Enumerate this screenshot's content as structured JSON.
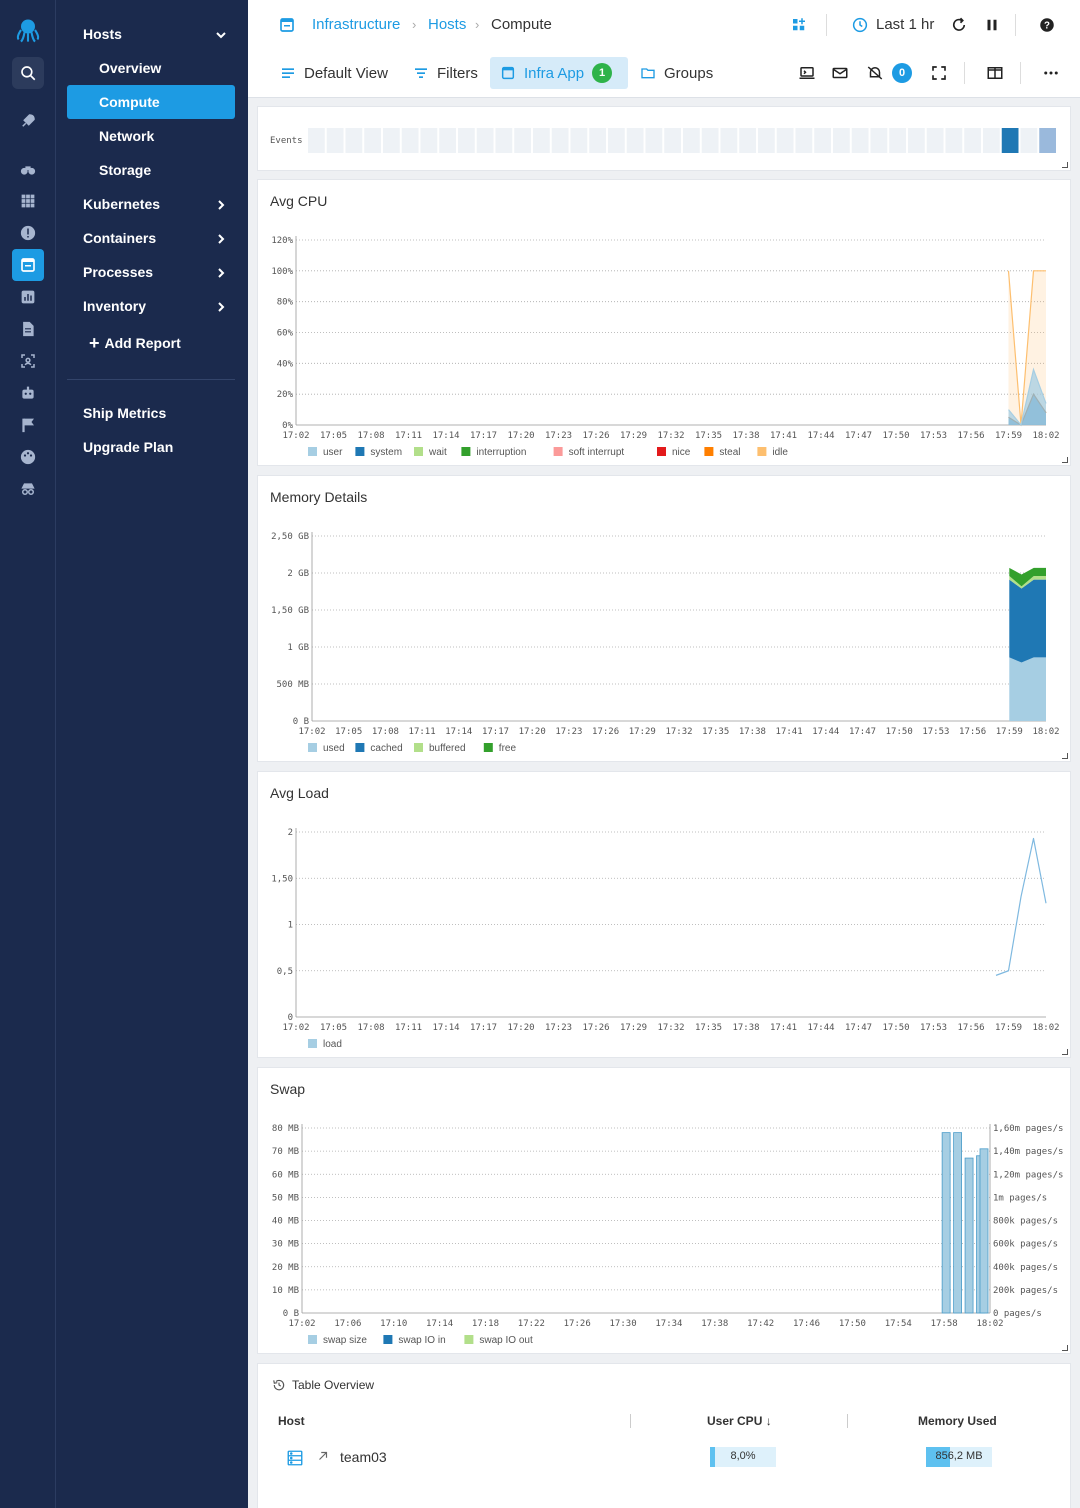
{
  "nav": {
    "hosts": "Hosts",
    "overview": "Overview",
    "compute": "Compute",
    "network": "Network",
    "storage": "Storage",
    "kubernetes": "Kubernetes",
    "containers": "Containers",
    "processes": "Processes",
    "inventory": "Inventory",
    "add_report": "Add Report",
    "ship_metrics": "Ship Metrics",
    "upgrade_plan": "Upgrade Plan"
  },
  "breadcrumb": {
    "infrastructure": "Infrastructure",
    "hosts": "Hosts",
    "current": "Compute"
  },
  "header": {
    "time_range": "Last 1 hr"
  },
  "toolbar": {
    "default_view": "Default View",
    "filters": "Filters",
    "infra_app": "Infra App",
    "infra_app_count": "1",
    "groups": "Groups",
    "alerts_count": "0"
  },
  "events": {
    "label": "Events"
  },
  "colors": {
    "accent": "#1d9be3",
    "nav_bg": "#1b2a4d",
    "green_badge": "#2eb34a"
  },
  "charts": {
    "cpu": {
      "title": "Avg CPU",
      "y_ticks": [
        "0%",
        "20%",
        "40%",
        "60%",
        "80%",
        "100%",
        "120%"
      ],
      "x_ticks": [
        "17:02",
        "17:05",
        "17:08",
        "17:11",
        "17:14",
        "17:17",
        "17:20",
        "17:23",
        "17:26",
        "17:29",
        "17:32",
        "17:35",
        "17:38",
        "17:41",
        "17:44",
        "17:47",
        "17:50",
        "17:53",
        "17:56",
        "17:59",
        "18:02"
      ],
      "legend": [
        {
          "label": "user",
          "color": "#a6cee3"
        },
        {
          "label": "system",
          "color": "#1f78b4"
        },
        {
          "label": "wait",
          "color": "#b2df8a"
        },
        {
          "label": "interruption",
          "color": "#33a02c"
        },
        {
          "label": "soft interrupt",
          "color": "#fb9a99"
        },
        {
          "label": "nice",
          "color": "#e31a1c"
        },
        {
          "label": "steal",
          "color": "#ff7f00"
        },
        {
          "label": "idle",
          "color": "#fdbf6f"
        }
      ]
    },
    "memory": {
      "title": "Memory Details",
      "y_ticks": [
        "0 B",
        "500 MB",
        "1 GB",
        "1,50 GB",
        "2 GB",
        "2,50 GB"
      ],
      "x_ticks": [
        "17:02",
        "17:05",
        "17:08",
        "17:11",
        "17:14",
        "17:17",
        "17:20",
        "17:23",
        "17:26",
        "17:29",
        "17:32",
        "17:35",
        "17:38",
        "17:41",
        "17:44",
        "17:47",
        "17:50",
        "17:53",
        "17:56",
        "17:59",
        "18:02"
      ],
      "legend": [
        {
          "label": "used",
          "color": "#a6cee3"
        },
        {
          "label": "cached",
          "color": "#1f78b4"
        },
        {
          "label": "buffered",
          "color": "#b2df8a"
        },
        {
          "label": "free",
          "color": "#33a02c"
        }
      ]
    },
    "load": {
      "title": "Avg Load",
      "y_ticks": [
        "0",
        "0,5",
        "1",
        "1,50",
        "2"
      ],
      "x_ticks": [
        "17:02",
        "17:05",
        "17:08",
        "17:11",
        "17:14",
        "17:17",
        "17:20",
        "17:23",
        "17:26",
        "17:29",
        "17:32",
        "17:35",
        "17:38",
        "17:41",
        "17:44",
        "17:47",
        "17:50",
        "17:53",
        "17:56",
        "17:59",
        "18:02"
      ],
      "legend": [
        {
          "label": "load",
          "color": "#a6cee3"
        }
      ]
    },
    "swap": {
      "title": "Swap",
      "y_ticks": [
        "0 B",
        "10 MB",
        "20 MB",
        "30 MB",
        "40 MB",
        "50 MB",
        "60 MB",
        "70 MB",
        "80 MB"
      ],
      "y2_ticks": [
        "0 pages/s",
        "200k pages/s",
        "400k pages/s",
        "600k pages/s",
        "800k pages/s",
        "1m pages/s",
        "1,20m pages/s",
        "1,40m pages/s",
        "1,60m pages/s"
      ],
      "x_ticks": [
        "17:02",
        "17:06",
        "17:10",
        "17:14",
        "17:18",
        "17:22",
        "17:26",
        "17:30",
        "17:34",
        "17:38",
        "17:42",
        "17:46",
        "17:50",
        "17:54",
        "17:58",
        "18:02"
      ],
      "legend": [
        {
          "label": "swap size",
          "color": "#a6cee3"
        },
        {
          "label": "swap IO in",
          "color": "#1f78b4"
        },
        {
          "label": "swap IO out",
          "color": "#b2df8a"
        }
      ]
    }
  },
  "chart_data": [
    {
      "type": "area",
      "title": "Avg CPU",
      "ylim": [
        0,
        120
      ],
      "x": [
        "17:59",
        "18:00",
        "18:01",
        "18:02"
      ],
      "series": [
        {
          "name": "user",
          "values": [
            10,
            0,
            36,
            14
          ]
        },
        {
          "name": "system",
          "values": [
            5,
            0,
            20,
            8
          ]
        },
        {
          "name": "idle",
          "values": [
            100,
            0,
            100,
            100
          ]
        }
      ]
    },
    {
      "type": "area",
      "title": "Memory Details",
      "ylim": [
        0,
        2.5
      ],
      "x": [
        "17:59",
        "18:00",
        "18:01",
        "18:02"
      ],
      "series": [
        {
          "name": "used",
          "values": [
            0.86,
            0.79,
            0.86,
            0.86
          ]
        },
        {
          "name": "cached",
          "values": [
            1.05,
            1.0,
            1.05,
            1.05
          ]
        },
        {
          "name": "buffered",
          "values": [
            0.05,
            0.03,
            0.05,
            0.05
          ]
        },
        {
          "name": "free",
          "values": [
            0.11,
            0.16,
            0.11,
            0.11
          ]
        }
      ]
    },
    {
      "type": "line",
      "title": "Avg Load",
      "ylim": [
        0,
        2
      ],
      "x": [
        "17:58",
        "17:59",
        "18:00",
        "18:01",
        "18:02"
      ],
      "series": [
        {
          "name": "load",
          "values": [
            0.45,
            0.5,
            1.3,
            1.93,
            1.23
          ]
        }
      ]
    },
    {
      "type": "bar",
      "title": "Swap",
      "ylim": [
        0,
        80
      ],
      "categories": [
        "17:58",
        "17:59",
        "18:00",
        "18:01",
        "18:02"
      ],
      "series": [
        {
          "name": "swap size",
          "values": [
            78,
            78,
            67,
            68,
            71
          ]
        }
      ]
    }
  ],
  "table": {
    "title": "Table Overview",
    "col_host": "Host",
    "col_cpu": "User CPU ↓",
    "col_mem": "Memory Used",
    "rows": [
      {
        "host": "team03",
        "cpu": "8,0%",
        "cpu_frac": 0.08,
        "mem": "856,2 MB",
        "mem_frac": 0.37
      }
    ]
  }
}
